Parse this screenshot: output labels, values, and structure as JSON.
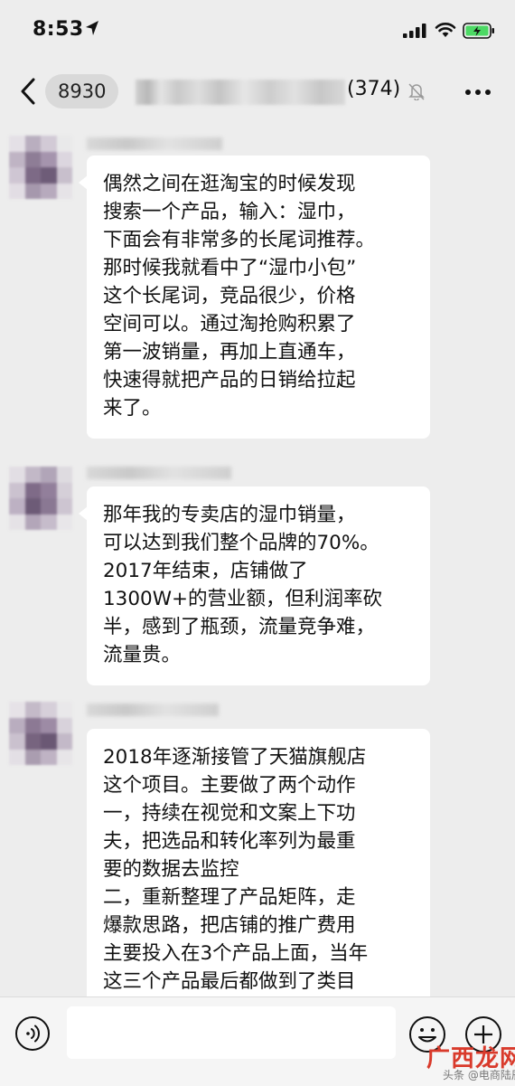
{
  "status_bar": {
    "time": "8:53",
    "icons": [
      "location-arrow-icon",
      "signal-icon",
      "wifi-icon",
      "battery-charging-icon"
    ],
    "battery_color": "#4cd964"
  },
  "nav": {
    "unread_count": "8930",
    "member_count": "(374)",
    "icons": [
      "back-chevron-icon",
      "mute-bell-icon",
      "more-dots-icon"
    ]
  },
  "messages": [
    {
      "text": "偶然之间在逛淘宝的时候发现\n搜索一个产品，输入：湿巾，\n下面会有非常多的长尾词推荐。\n那时候我就看中了“湿巾小包”\n这个长尾词，竞品很少，价格\n空间可以。通过淘抢购积累了\n第一波销量，再加上直通车，\n快速得就把产品的日销给拉起\n来了。"
    },
    {
      "text": "那年我的专卖店的湿巾销量，\n可以达到我们整个品牌的70%。\n2017年结束，店铺做了\n1300W+的营业额，但利润率砍\n半，感到了瓶颈，流量竞争难，\n流量贵。"
    },
    {
      "text": "2018年逐渐接管了天猫旗舰店\n这个项目。主要做了两个动作\n一，持续在视觉和文案上下功\n夫，把选品和转化率列为最重\n要的数据去监控\n二，重新整理了产品矩阵，走\n爆款思路，把店铺的推广费用\n主要投入在3个产品上面，当年\n这三个产品最后都做到了类目"
    }
  ],
  "input_bar": {
    "input_value": "",
    "icons": [
      "voice-icon",
      "emoji-icon",
      "plus-icon"
    ]
  },
  "watermark": {
    "logo": "广西龙网",
    "credit": "头条 @电商陆辰"
  },
  "colors": {
    "background": "#ededed",
    "bubble": "#ffffff",
    "watermark": "#d93a2b"
  }
}
